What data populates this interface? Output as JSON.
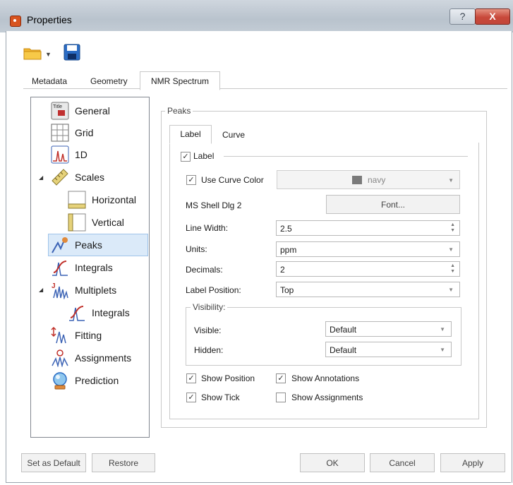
{
  "window": {
    "title": "Properties",
    "help_glyph": "?",
    "close_glyph": "X"
  },
  "tabs": [
    "Metadata",
    "Geometry",
    "NMR Spectrum"
  ],
  "active_tab": "NMR Spectrum",
  "tree": [
    {
      "label": "General",
      "icon": "title-icon"
    },
    {
      "label": "Grid",
      "icon": "grid-icon"
    },
    {
      "label": "1D",
      "icon": "spectrum-1d-icon"
    },
    {
      "label": "Scales",
      "icon": "ruler-icon"
    },
    {
      "label": "Horizontal",
      "icon": "horizontal-ruler-icon"
    },
    {
      "label": "Vertical",
      "icon": "vertical-ruler-icon"
    },
    {
      "label": "Peaks",
      "icon": "peaks-icon"
    },
    {
      "label": "Integrals",
      "icon": "integrals-icon"
    },
    {
      "label": "Multiplets",
      "icon": "multiplets-icon"
    },
    {
      "label": "Integrals",
      "icon": "integrals-icon"
    },
    {
      "label": "Fitting",
      "icon": "fitting-icon"
    },
    {
      "label": "Assignments",
      "icon": "assignments-icon"
    },
    {
      "label": "Prediction",
      "icon": "prediction-icon"
    }
  ],
  "selected_tree_item": "Peaks",
  "peaks": {
    "group_title": "Peaks",
    "inner_tabs": [
      "Label",
      "Curve"
    ],
    "label_group": "Label",
    "label_checked": true,
    "use_curve_color": {
      "label": "Use Curve Color",
      "checked": true,
      "color_name": "navy",
      "swatch": "#7a7a7a"
    },
    "font_name": "MS Shell Dlg 2",
    "font_button": "Font...",
    "line_width": {
      "label": "Line Width:",
      "value": "2.5"
    },
    "units": {
      "label": "Units:",
      "value": "ppm"
    },
    "decimals": {
      "label": "Decimals:",
      "value": "2"
    },
    "label_position": {
      "label": "Label Position:",
      "value": "Top"
    },
    "visibility": {
      "title": "Visibility:",
      "visible_label": "Visible:",
      "visible_value": "Default",
      "hidden_label": "Hidden:",
      "hidden_value": "Default"
    },
    "checks": {
      "show_position": {
        "label": "Show Position",
        "checked": true
      },
      "show_annotations": {
        "label": "Show Annotations",
        "checked": true
      },
      "show_tick": {
        "label": "Show Tick",
        "checked": true
      },
      "show_assignments": {
        "label": "Show Assignments",
        "checked": false
      }
    }
  },
  "buttons": {
    "set_default": "Set as Default",
    "restore": "Restore",
    "ok": "OK",
    "cancel": "Cancel",
    "apply": "Apply"
  },
  "glyphs": {
    "check": "✓",
    "dropdown": "▼",
    "spin": "▲▼",
    "expand": "◢"
  },
  "colors": {
    "accent_blue": "#1f5fbf",
    "selection": "#dbeaf9"
  }
}
